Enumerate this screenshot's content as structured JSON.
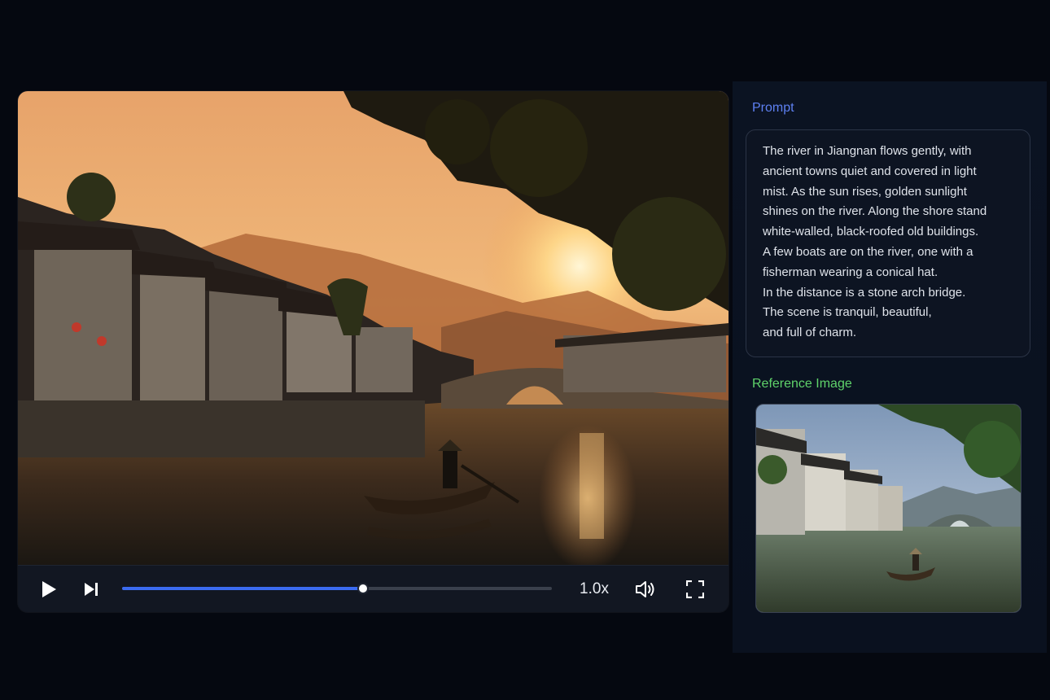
{
  "player": {
    "play_icon": "play-icon",
    "next_icon": "skip-next-icon",
    "progress": 0.56,
    "speed": "1.0x",
    "volume_icon": "volume-icon",
    "fullscreen_icon": "fullscreen-icon",
    "accent_color": "#3b6bf0"
  },
  "prompt": {
    "label": "Prompt",
    "label_color": "#5e80f2",
    "lines": [
      "The river in Jiangnan flows gently, with",
      "ancient towns quiet and covered in light",
      "mist. As the sun rises, golden sunlight",
      "shines on the river. Along the shore stand",
      "white-walled, black-roofed old buildings.",
      "A few boats are on the river, one with a",
      "fisherman wearing a conical hat.",
      "In the distance is a stone arch bridge.",
      "The scene is tranquil, beautiful,",
      "and full of charm."
    ]
  },
  "reference": {
    "label": "Reference Image",
    "label_color": "#5fd36a"
  }
}
